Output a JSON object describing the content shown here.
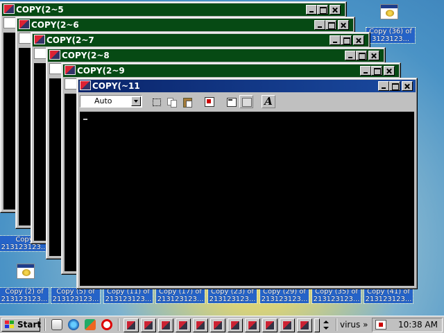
{
  "desktop": {
    "icons_top_right": [
      {
        "label": "Copy (36) of",
        "label2": "3123123..."
      }
    ],
    "icons_left": [
      {
        "label": "Copy",
        "label2": "213123123..."
      }
    ],
    "bottom_labels": [
      {
        "line1": "Copy (2) of",
        "line2": "213123123..."
      },
      {
        "line1": "Copy (5) of",
        "line2": "213123123..."
      },
      {
        "line1": "Copy (11) of",
        "line2": "213123123..."
      },
      {
        "line1": "Copy (17) of",
        "line2": "213123123..."
      },
      {
        "line1": "Copy (23) of",
        "line2": "213123123..."
      },
      {
        "line1": "Copy (29) of",
        "line2": "213123123..."
      },
      {
        "line1": "Copy (35) of",
        "line2": "213123123..."
      },
      {
        "line1": "Copy (41) of",
        "line2": "213123123..."
      }
    ]
  },
  "windows": [
    {
      "title": "COPY(2~5"
    },
    {
      "title": "COPY(2~6"
    },
    {
      "title": "COPY(2~7"
    },
    {
      "title": "COPY(2~8"
    },
    {
      "title": "COPY(2~9"
    },
    {
      "title": "COPY(~11"
    }
  ],
  "active_window": {
    "font_size_value": "Auto",
    "cursor": "_"
  },
  "taskbar": {
    "start_label": "Start",
    "toolbar_name": "virus",
    "clock": "10:38 AM",
    "task_buttons_count": 12
  },
  "colors": {
    "inactive_title": "#064a14",
    "active_title": "#0a246a",
    "console_bg": "#000000",
    "face": "#c0c0c0"
  }
}
